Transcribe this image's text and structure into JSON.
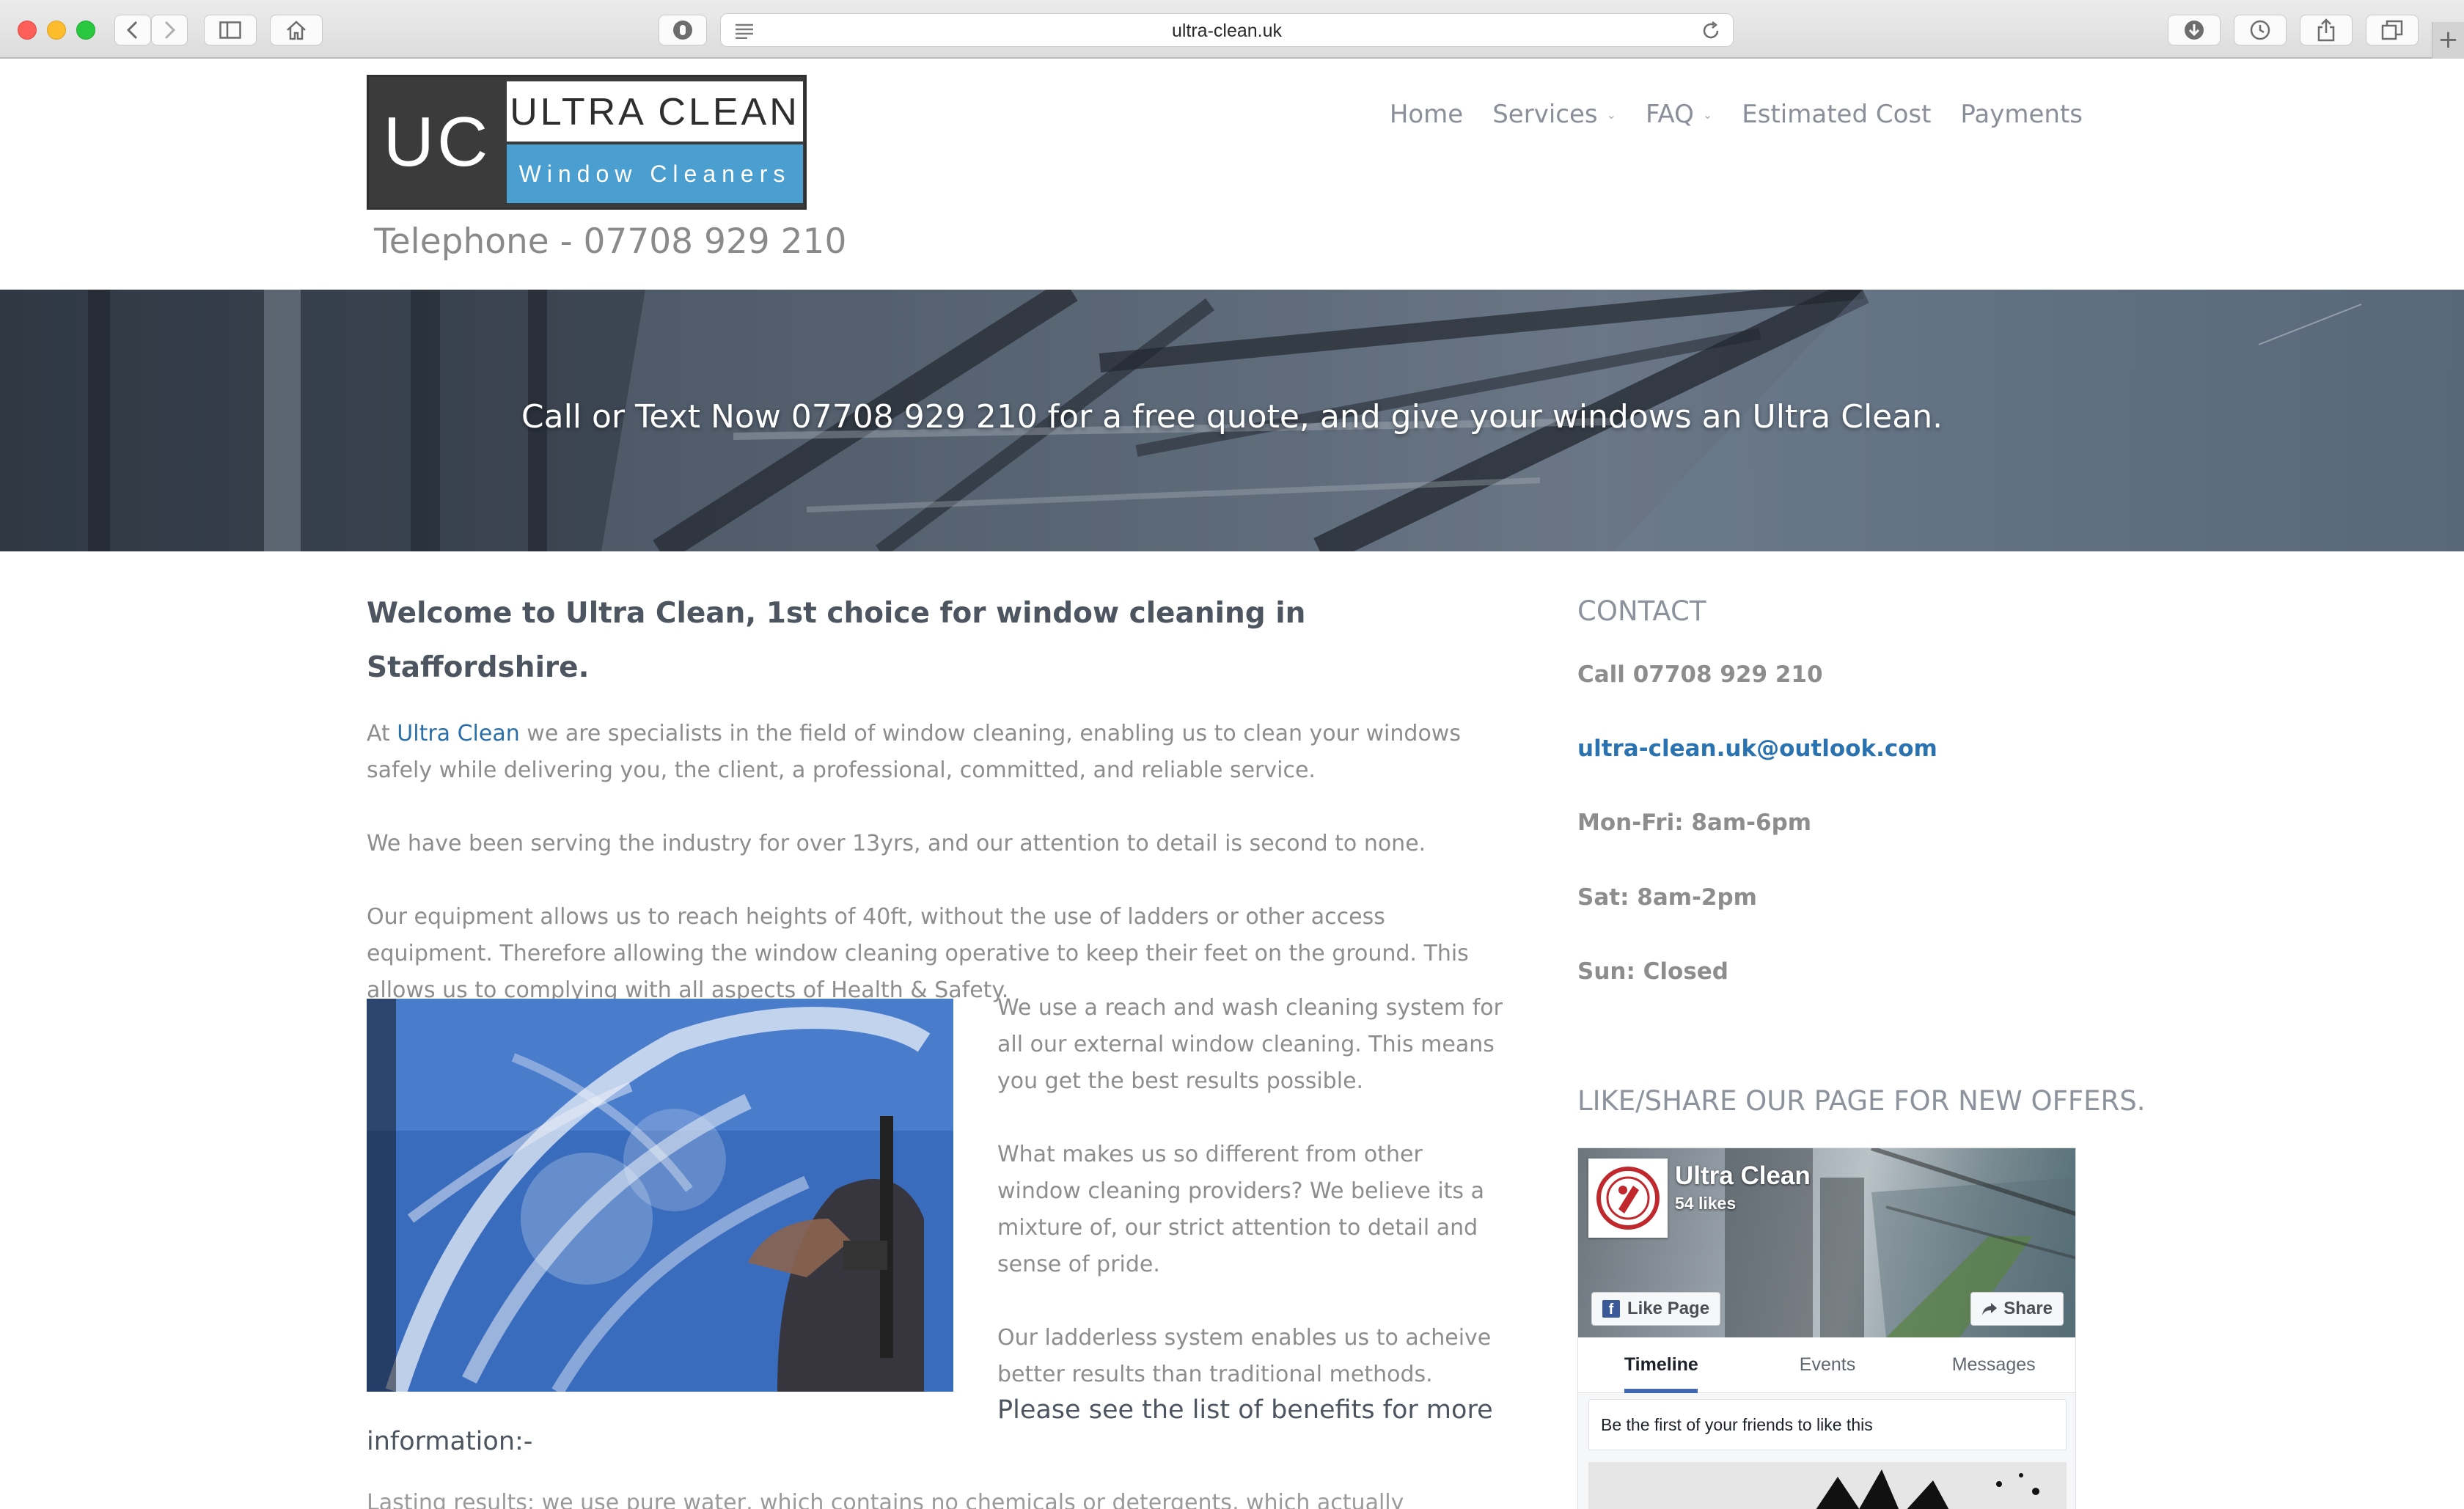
{
  "browser": {
    "url": "ultra-clean.uk",
    "buttons": {
      "back": "back-icon",
      "forward": "forward-icon",
      "sidebar": "sidebar-icon",
      "home": "home-icon",
      "privacy": "privacy-icon",
      "reader": "reader-icon",
      "reload": "reload-icon",
      "downloads": "download-icon",
      "history": "history-icon",
      "share": "share-icon",
      "tabs": "tabs-icon",
      "new_tab": "+"
    }
  },
  "header": {
    "logo": {
      "initials": "UC",
      "name": "ULTRA CLEAN",
      "tagline": "Window Cleaners"
    },
    "telephone": "Telephone - 07708 929 210",
    "nav": [
      {
        "label": "Home",
        "has_dropdown": false
      },
      {
        "label": "Services",
        "has_dropdown": true
      },
      {
        "label": "FAQ",
        "has_dropdown": true
      },
      {
        "label": "Estimated Cost",
        "has_dropdown": false
      },
      {
        "label": "Payments",
        "has_dropdown": false
      }
    ]
  },
  "hero": {
    "text": "Call or Text Now 07708 929 210 for a free quote, and give your windows an Ultra Clean."
  },
  "main": {
    "welcome": "Welcome to Ultra Clean, 1st choice for window cleaning in Staffordshire.",
    "intro_prefix": "At ",
    "intro_link": "Ultra Clean",
    "intro_suffix": " we are specialists in the field of window cleaning, enabling us to clean your windows safely while delivering you, the client, a professional, committed, and reliable service.",
    "para2": "We have been serving the industry for over 13yrs, and our attention to detail is second to none.",
    "para3": "Our equipment allows us to reach heights of 40ft, without the use of ladders or other access equipment. Therefore allowing the window cleaning operative to keep their feet on the ground. This allows us to complying with all aspects of Health & Safety.",
    "side1": "We use a reach and wash cleaning system for all our external window cleaning. This means you get the best results possible.",
    "side2": "What makes us so different from other window cleaning providers? We believe its a mixture of, our strict attention to detail and sense of pride.",
    "side3": "Our ladderless system enables us to acheive better results than traditional methods.",
    "benefits_a": "Please see the list of benefits for more",
    "benefits_b": "information:-",
    "lasting": "Lasting results: we use pure water, which contains no chemicals or detergents, which actually"
  },
  "sidebar": {
    "contact_heading": "CONTACT",
    "phone": "Call 07708 929 210",
    "email": "ultra-clean.uk@outlook.com",
    "hours": [
      "Mon-Fri: 8am-6pm",
      "Sat: 8am-2pm",
      "Sun: Closed"
    ],
    "like_heading": "LIKE/SHARE OUR PAGE FOR NEW OFFERS.",
    "facebook": {
      "page_name": "Ultra Clean",
      "likes": "54 likes",
      "like_button": "Like Page",
      "share_button": "Share",
      "tabs": [
        "Timeline",
        "Events",
        "Messages"
      ],
      "active_tab": "Timeline",
      "friends_text": "Be the first of your friends to like this"
    }
  },
  "colors": {
    "link": "#2b6fa8",
    "logo_blue": "#4a9ed0",
    "logo_dark": "#3b3b3b",
    "facebook_blue": "#3b5998"
  }
}
